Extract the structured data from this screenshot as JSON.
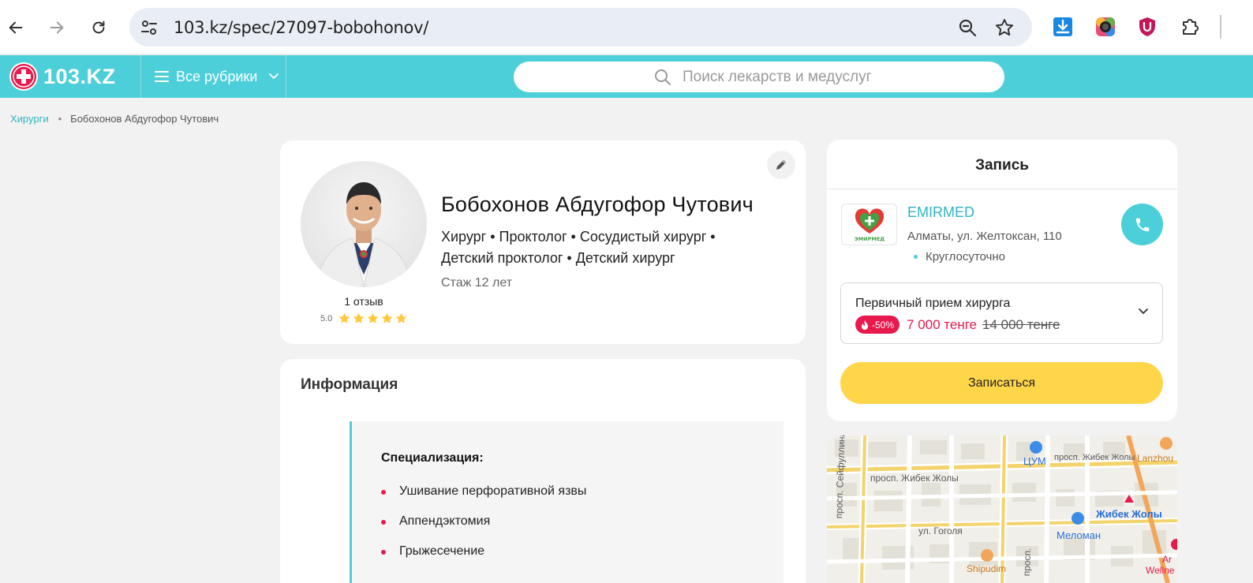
{
  "browser": {
    "url": "103.kz/spec/27097-bobohonov/",
    "icons": [
      "back-icon",
      "forward-icon",
      "reload-icon",
      "site-settings-icon",
      "zoom-icon",
      "bookmark-star-icon",
      "download-icon",
      "extension-icon",
      "shield-extension-icon",
      "puzzle-icon"
    ]
  },
  "header": {
    "logo_text": "103.KZ",
    "rubrics_label": "Все рубрики",
    "search_placeholder": "Поиск лекарств и медуслуг",
    "colors": {
      "brand": "#4ccfd9",
      "accent": "#e8194d"
    }
  },
  "breadcrumb": {
    "items": [
      "Хирурги",
      "Бобохонов Абдугофор Чутович"
    ]
  },
  "profile": {
    "name": "Бобохонов Абдугофор Чутович",
    "specialties": "Хирург • Проктолог • Сосудистый хирург • Детский проктолог • Детский хирург",
    "experience": "Стаж 12 лет",
    "reviews": "1 отзыв",
    "rating": "5.0",
    "stars": 5
  },
  "info": {
    "title": "Информация",
    "spec_title": "Специализация:",
    "spec_items": [
      "Ушивание перфоративной язвы",
      "Аппендэктомия",
      "Грыжесечение"
    ]
  },
  "booking": {
    "title": "Запись",
    "clinic_name": "EMIRMED",
    "clinic_address": "Алматы, ул. Желтоксан, 110",
    "clinic_hours": "Круглосуточно",
    "clinic_logo_text": "ЭМИРМЕД",
    "service_name": "Первичный прием хирурга",
    "discount": "-50%",
    "price_new": "7 000 тенге",
    "price_old": "14 000 тенге",
    "button_label": "Записаться"
  },
  "map": {
    "labels": [
      "просп. Жибек Жолы",
      "ЦУМ",
      "просп. Жибек Жолы",
      "Lanzhou",
      "просп. Сейфуллина",
      "Жибек Жолы",
      "ул. Гоголя",
      "Меломан",
      "Shipudim",
      "просп.",
      "Ar",
      "Wellne"
    ]
  }
}
